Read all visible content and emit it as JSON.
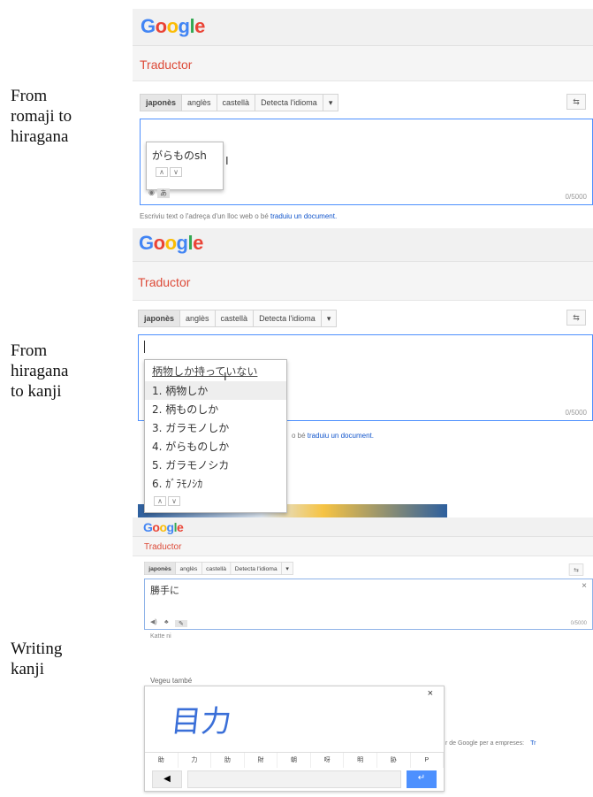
{
  "labels": [
    "From\nromaji to\nhiragana",
    "From\nhiragana\nto kanji",
    "Writing\nkanji"
  ],
  "logo": [
    "G",
    "o",
    "o",
    "g",
    "l",
    "e"
  ],
  "translator_title": "Traductor",
  "langs": [
    "japonès",
    "anglès",
    "castellà",
    "Detecta l'idioma",
    "▾"
  ],
  "swap_icon": "⇆",
  "panel1": {
    "input_text": "がらものsh",
    "counter": "0/5000",
    "hint_prefix": "Escriviu text o l'adreça d'un lloc web o bé ",
    "hint_link": "traduiu un document."
  },
  "panel2": {
    "composition": "柄物しか持っていない",
    "candidates": [
      "1. 柄物しか",
      "2. 柄ものしか",
      "3. ガラモノしか",
      "4. がらものしか",
      "5. ガラモノシカ",
      "6. ｶﾞﾗﾓﾉｼｶ"
    ],
    "counter": "0/5000",
    "hint_prefix": "o bé ",
    "hint_link": "traduiu un document."
  },
  "panel3": {
    "input_text": "勝手に",
    "close_x": "×",
    "romaji": "Katte ni",
    "counter": "0/5000",
    "see_also": "Vegeu també",
    "drawn_kanji": "目力",
    "hw_close": "×",
    "hw_candidates": [
      "助",
      "力",
      "肋",
      "財",
      "朝",
      "呀",
      "明",
      "胁",
      "P"
    ],
    "business_text": "r de Google per a empreses:",
    "business_link": "Tr"
  }
}
